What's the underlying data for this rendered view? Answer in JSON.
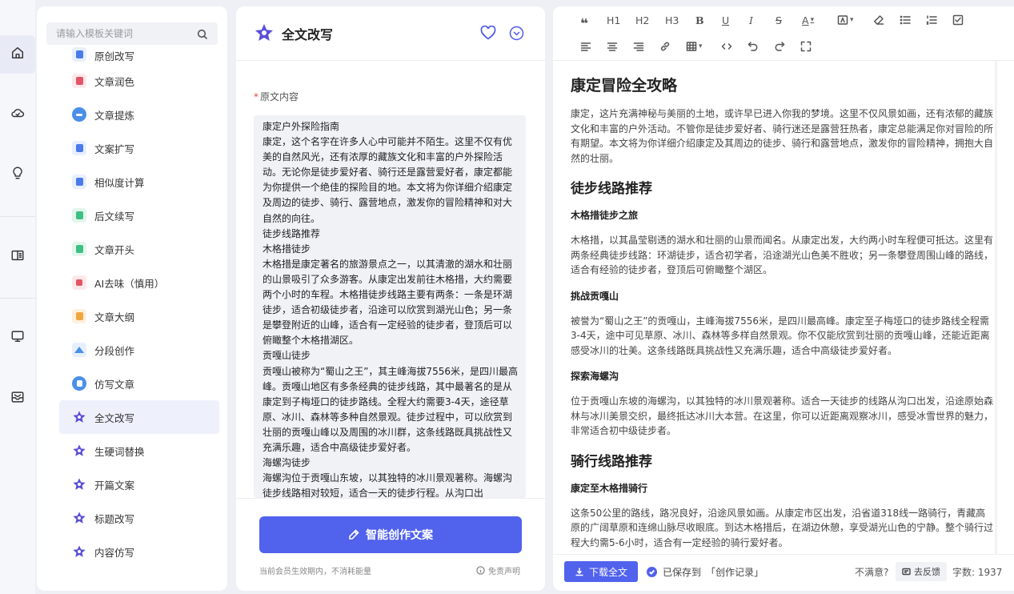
{
  "rail": {
    "items": [
      {
        "icon": "home-icon"
      },
      {
        "icon": "cloud-icon"
      },
      {
        "icon": "lightbulb-icon"
      },
      {
        "icon": "book-icon"
      },
      {
        "icon": "monitor-icon"
      },
      {
        "icon": "inbox-icon"
      }
    ]
  },
  "templates": {
    "search_placeholder": "请输入模板关键词",
    "items": [
      {
        "label": "原创改写",
        "color": "#4a7be8"
      },
      {
        "label": "文章润色",
        "color": "#e25566"
      },
      {
        "label": "文章提炼",
        "color": "#4a8fe8"
      },
      {
        "label": "文案扩写",
        "color": "#4a7be8"
      },
      {
        "label": "相似度计算",
        "color": "#4a7be8"
      },
      {
        "label": "后文续写",
        "color": "#3fbf84"
      },
      {
        "label": "文章开头",
        "color": "#3fbf84"
      },
      {
        "label": "AI去味（慎用）",
        "color": "#e25566"
      },
      {
        "label": "文章大纲",
        "color": "#f0a640"
      },
      {
        "label": "分段创作",
        "color": "#4a8fe8"
      },
      {
        "label": "仿写文章",
        "color": "#4a8fe8"
      },
      {
        "label": "全文改写",
        "color": "#5a4fd8"
      },
      {
        "label": "生硬词替换",
        "color": "#5a4fd8"
      },
      {
        "label": "开篇文案",
        "color": "#5a4fd8"
      },
      {
        "label": "标题改写",
        "color": "#5a4fd8"
      },
      {
        "label": "内容仿写",
        "color": "#5a4fd8"
      }
    ]
  },
  "source": {
    "title": "全文改写",
    "label": "原文内容",
    "required_mark": "*",
    "text": "康定户外探险指南\n康定，这个名字在许多人心中可能并不陌生。这里不仅有优美的自然风光，还有浓厚的藏族文化和丰富的户外探险活动。无论你是徒步爱好者、骑行还是露营爱好者，康定都能为你提供一个绝佳的探险目的地。本文将为你详细介绍康定及周边的徒步、骑行、露营地点，激发你的冒险精神和对大自然的向往。\n徒步线路推荐\n木格措徒步\n木格措是康定著名的旅游景点之一，以其清澈的湖水和壮丽的山景吸引了众多游客。从康定出发前往木格措，大约需要两个小时的车程。木格措徒步线路主要有两条：一条是环湖徒步，适合初级徒步者，沿途可以欣赏到湖光山色；另一条是攀登附近的山峰，适合有一定经验的徒步者，登顶后可以俯瞰整个木格措湖区。\n贡嘎山徒步\n贡嘎山被称为“蜀山之王”，其主峰海拔7556米，是四川最高峰。贡嘎山地区有多条经典的徒步线路，其中最著名的是从康定到子梅垭口的徒步路线。全程大约需要3-4天，途径草原、冰川、森林等多种自然景观。徒步过程中，可以欣赏到壮丽的贡嘎山峰以及周围的冰川群，这条线路既具挑战性又充满乐趣，适合中高级徒步爱好者。\n海螺沟徒步\n海螺沟位于贡嘎山东坡，以其独特的冰川景观著称。海螺沟徒步线路相对较短，适合一天的徒步行程。从沟口出",
    "generate_label": "智能创作文案",
    "member_note": "当前会员生效期内，不消耗能量",
    "disclaimer": "免责声明"
  },
  "editor": {
    "toolbar_row1": [
      "❝",
      "H1",
      "H2",
      "H3",
      "B",
      "U",
      "I",
      "S",
      "A",
      "bg-color-icon",
      "eraser-icon",
      "bullet-list-icon",
      "ordered-list-icon",
      "checklist-icon"
    ],
    "doc": {
      "title": "康定冒险全攻略",
      "intro": "康定，这片充满神秘与美丽的土地，或许早已进入你我的梦境。这里不仅风景如画，还有浓郁的藏族文化和丰富的户外活动。不管你是徒步爱好者、骑行迷还是露营狂热者，康定总能满足你对冒险的所有期望。本文将为你详细介绍康定及其周边的徒步、骑行和露营地点，激发你的冒险精神，拥抱大自然的壮丽。",
      "h2_hike": "徒步线路推荐",
      "h3_mugecuo": "木格措徒步之旅",
      "p_mugecuo": "木格措，以其晶莹剔透的湖水和壮丽的山景而闻名。从康定出发，大约两小时车程便可抵达。这里有两条经典徒步线路：环湖徒步，适合初学者，沿途湖光山色美不胜收；另一条攀登周围山峰的路线，适合有经验的徒步者，登顶后可俯瞰整个湖区。",
      "h3_gongga": "挑战贡嘎山",
      "p_gongga": "被誉为“蜀山之王”的贡嘎山，主峰海拔7556米，是四川最高峰。康定至子梅垭口的徒步路线全程需3-4天，途中可见草原、冰川、森林等多样自然景观。你不仅能欣赏到壮丽的贡嘎山峰，还能近距离感受冰川的壮美。这条线路既具挑战性又充满乐趣，适合中高级徒步爱好者。",
      "h3_hailuogou": "探索海螺沟",
      "p_hailuogou": "位于贡嘎山东坡的海螺沟，以其独特的冰川景观著称。适合一天徒步的线路从沟口出发，沿途原始森林与冰川美景交织，最终抵达冰川大本营。在这里，你可以近距离观察冰川，感受冰雪世界的魅力，非常适合初中级徒步者。",
      "h2_ride": "骑行线路推荐",
      "h3_ride": "康定至木格措骑行",
      "p_ride": "这条50公里的路线，路况良好，沿途风景如画。从康定市区出发，沿省道318线一路骑行，青藏高原的广阔草原和连绵山脉尽收眼底。到达木格措后，在湖边休憩，享受湖光山色的宁静。整个骑行过程大约需5-6小时，适合有一定经验的骑行爱好者。"
    },
    "download_label": "下载全文",
    "saved_prefix": "已保存到",
    "saved_target": "「创作记录」",
    "unsatisfied": "不满意?",
    "feedback_label": "去反馈",
    "word_count_label": "字数: 1937"
  }
}
